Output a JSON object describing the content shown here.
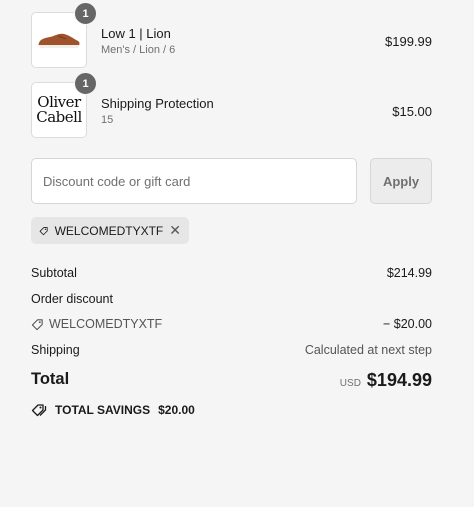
{
  "line_items": [
    {
      "quantity": "1",
      "name": "Low 1 | Lion",
      "variant": "Men's / Lion / 6",
      "price": "$199.99",
      "thumbnail": "sneaker-image"
    },
    {
      "quantity": "1",
      "name": "Shipping Protection",
      "variant": "15",
      "price": "$15.00",
      "logo_line1": "Oliver",
      "logo_line2": "Cabell"
    }
  ],
  "discount": {
    "placeholder": "Discount code or gift card",
    "apply_label": "Apply",
    "applied_code": "WELCOMEDTYXTF"
  },
  "summary": {
    "subtotal_label": "Subtotal",
    "subtotal_value": "$214.99",
    "order_discount_label": "Order discount",
    "discount_code": "WELCOMEDTYXTF",
    "discount_value": "− $20.00",
    "shipping_label": "Shipping",
    "shipping_value": "Calculated at next step",
    "total_label": "Total",
    "currency": "USD",
    "total_value": "$194.99",
    "savings_label": "TOTAL SAVINGS",
    "savings_value": "$20.00"
  },
  "colors": {
    "background": "#f5f5f5",
    "badge": "#666666",
    "tag_background": "#e6e6e6"
  }
}
